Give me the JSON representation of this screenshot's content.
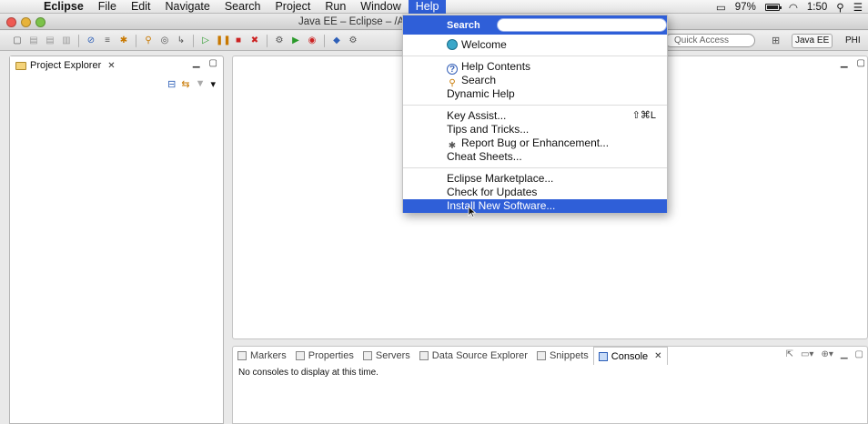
{
  "menubar": {
    "apple": "",
    "items": [
      "Eclipse",
      "File",
      "Edit",
      "Navigate",
      "Search",
      "Project",
      "Run",
      "Window",
      "Help"
    ],
    "battery": "97%",
    "clock": "1:50"
  },
  "window": {
    "title": "Java EE – Eclipse – /A"
  },
  "toolbar": {
    "quick_access_placeholder": "Quick Access",
    "perspective_active": "Java EE",
    "perspective_other": "PHI"
  },
  "explorer": {
    "tab_label": "Project Explorer"
  },
  "bottom": {
    "tabs": [
      "Markers",
      "Properties",
      "Servers",
      "Data Source Explorer",
      "Snippets",
      "Console"
    ],
    "console_message": "No consoles to display at this time."
  },
  "help_menu": {
    "search_label": "Search",
    "group1": [
      "Welcome"
    ],
    "group2": [
      "Help Contents",
      "Search",
      "Dynamic Help"
    ],
    "group3": [
      "Key Assist...",
      "Tips and Tricks...",
      "Report Bug or Enhancement...",
      "Cheat Sheets..."
    ],
    "key_assist_shortcut": "⇧⌘L",
    "group4": [
      "Eclipse Marketplace...",
      "Check for Updates",
      "Install New Software..."
    ]
  },
  "colors": {
    "highlight": "#2f5fd8"
  }
}
